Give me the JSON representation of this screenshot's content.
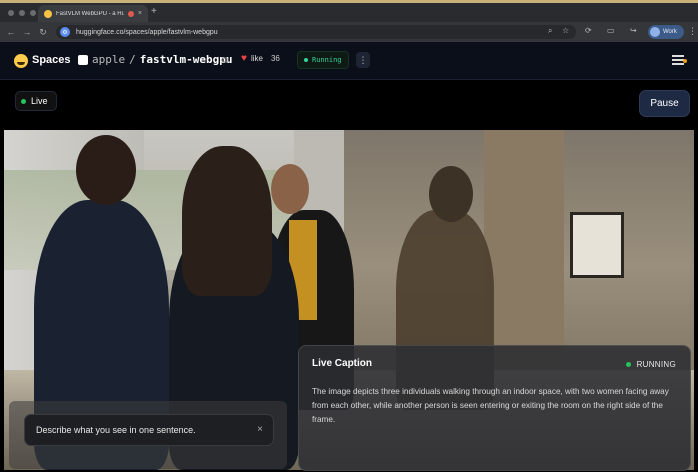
{
  "browser": {
    "tab_title": "FastVLM WebGPU - a Hu",
    "tab_close": "×",
    "new_tab": "+",
    "url": "huggingface.co/spaces/apple/fastvlm-webgpu",
    "profile_label": "Work",
    "icons": [
      "back-icon",
      "forward-icon",
      "reload-icon",
      "zoom-icon",
      "star-icon",
      "extensions-icon",
      "more-icon"
    ]
  },
  "header": {
    "spaces_label": "Spaces",
    "org": "apple",
    "separator": "/",
    "repo": "fastvlm-webgpu",
    "like_label": "like",
    "like_count": "36",
    "status": "Running",
    "more_glyph": "⋮"
  },
  "app": {
    "live_label": "Live",
    "pause_label": "Pause",
    "caption": {
      "title": "Live Caption",
      "status": "RUNNING",
      "text": "The image depicts three individuals walking through an indoor space, with two women facing away from each other, while another person is seen entering or exiting the room on the right side of the frame."
    },
    "prompt": {
      "value": "Describe what you see in one sentence.",
      "clear_glyph": "×"
    }
  },
  "colors": {
    "accent_green": "#22c55e",
    "like_red": "#ef4444",
    "hf_yellow": "#ffcc4d",
    "header_bg": "#0b0f19"
  }
}
